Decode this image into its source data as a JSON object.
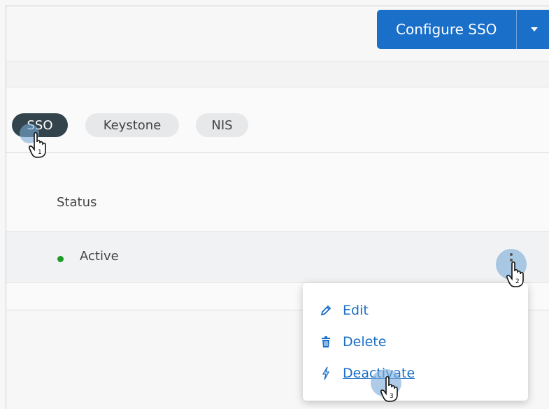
{
  "header": {
    "configure_label": "Configure SSO",
    "dropdown_icon": "caret-down-icon",
    "accent_color": "#1a6fc9"
  },
  "tabs": [
    {
      "label": "SSO",
      "selected": true
    },
    {
      "label": "Keystone",
      "selected": false
    },
    {
      "label": "NIS",
      "selected": false
    }
  ],
  "table": {
    "column_header": "Status",
    "rows": [
      {
        "status": "Active",
        "status_color": "#1e9b2a"
      }
    ]
  },
  "row_menu": {
    "items": [
      {
        "label": "Edit",
        "icon": "pencil-icon"
      },
      {
        "label": "Delete",
        "icon": "trash-icon"
      },
      {
        "label": "Deactivate",
        "icon": "lightning-icon"
      }
    ]
  },
  "step_markers": [
    "1",
    "2",
    "3"
  ]
}
